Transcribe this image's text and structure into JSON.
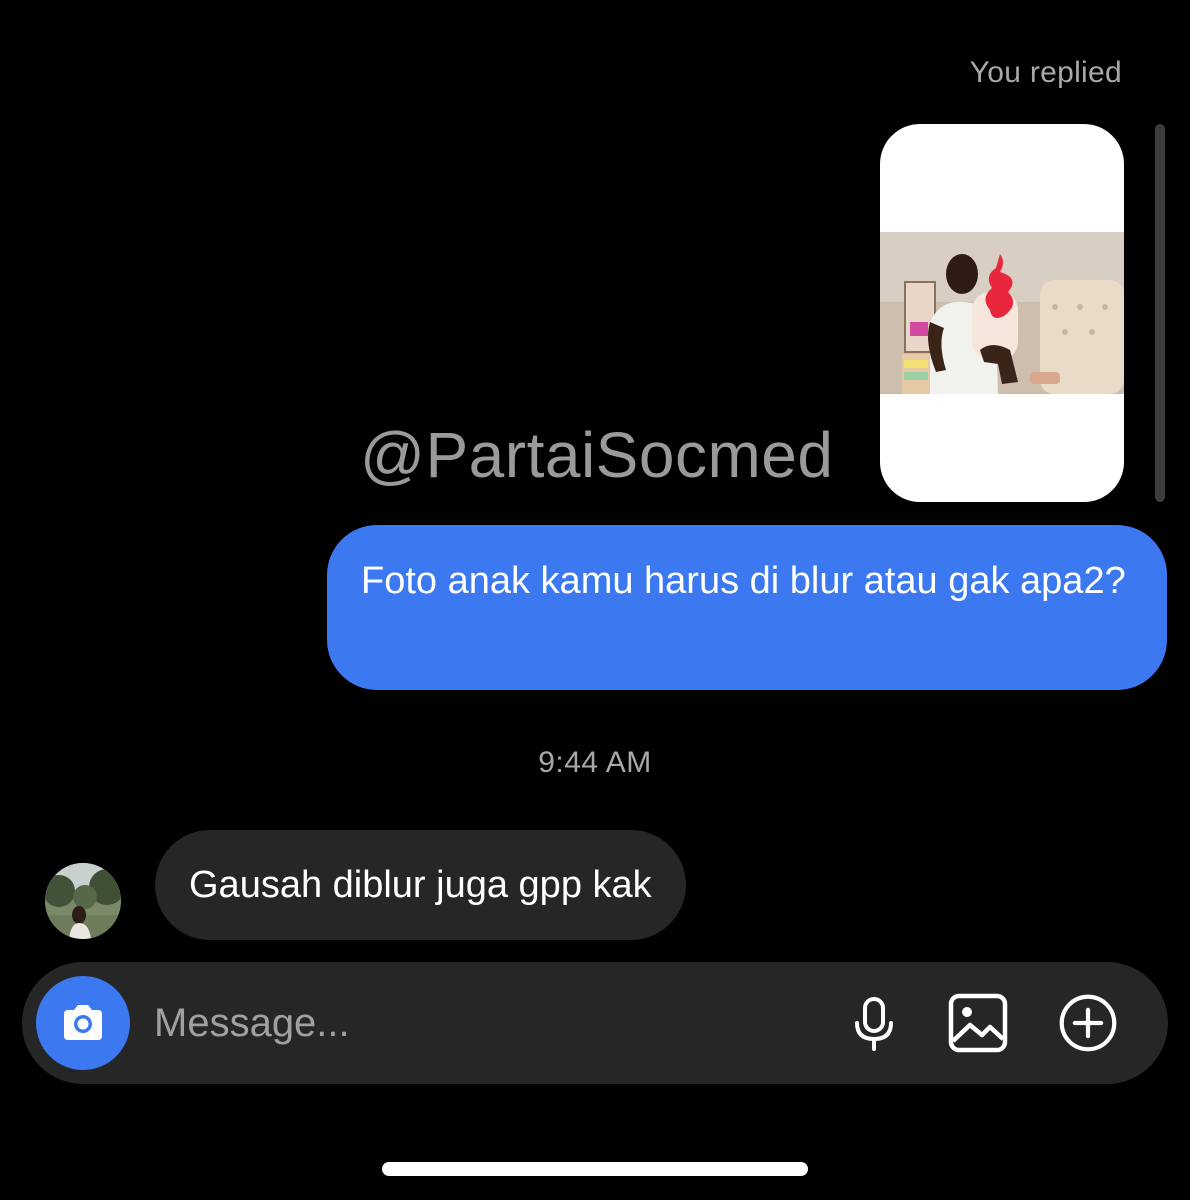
{
  "header": {
    "replied_label": "You replied"
  },
  "story_reply": {
    "watermark": "@PartaiSocmed"
  },
  "messages": [
    {
      "direction": "sent",
      "text": "Foto anak kamu harus di blur atau gak apa2?"
    },
    {
      "direction": "received",
      "text": "Gausah diblur juga gpp kak"
    }
  ],
  "timestamp": "9:44 AM",
  "composer": {
    "placeholder": "Message...",
    "icons": [
      "camera-icon",
      "microphone-icon",
      "gallery-icon",
      "plus-circle-icon"
    ]
  },
  "colors": {
    "background": "#000000",
    "sent_bubble": "#3c78f0",
    "received_bubble": "#262626",
    "composer": "#262626",
    "muted_text": "#a8a8a8"
  }
}
